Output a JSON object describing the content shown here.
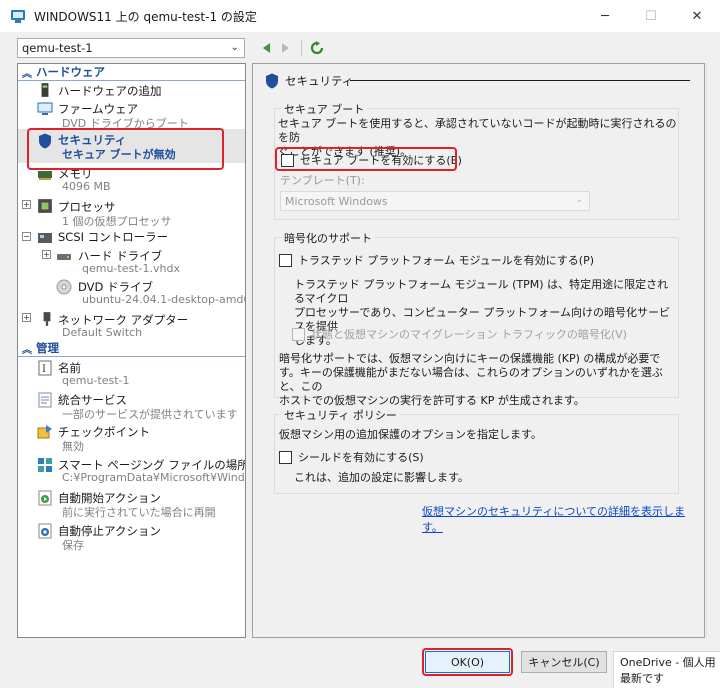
{
  "window": {
    "title": "WINDOWS11 上の qemu-test-1 の設定"
  },
  "vm_selector": {
    "value": "qemu-test-1"
  },
  "tree": {
    "hardware_section": "ハードウェア",
    "management_section": "管理",
    "add_hardware": "ハードウェアの追加",
    "firmware": {
      "label": "ファームウェア",
      "sub": "DVD ドライブからブート"
    },
    "security": {
      "label": "セキュリティ",
      "sub": "セキュア ブートが無効"
    },
    "memory": {
      "label": "メモリ",
      "sub": "4096 MB"
    },
    "processor": {
      "label": "プロセッサ",
      "sub": "1 個の仮想プロセッサ"
    },
    "scsi": {
      "label": "SCSI コントローラー"
    },
    "hard_drive": {
      "label": "ハード ドライブ",
      "sub": "qemu-test-1.vhdx"
    },
    "dvd_drive": {
      "label": "DVD ドライブ",
      "sub": "ubuntu-24.04.1-desktop-amd6..."
    },
    "network": {
      "label": "ネットワーク アダプター",
      "sub": "Default Switch"
    },
    "name": {
      "label": "名前",
      "sub": "qemu-test-1"
    },
    "integration": {
      "label": "統合サービス",
      "sub": "一部のサービスが提供されています"
    },
    "checkpoint": {
      "label": "チェックポイント",
      "sub": "無効"
    },
    "smart_paging": {
      "label": "スマート ページング ファイルの場所",
      "sub": "C:¥ProgramData¥Microsoft¥Windo..."
    },
    "auto_start": {
      "label": "自動開始アクション",
      "sub": "前に実行されていた場合に再開"
    },
    "auto_stop": {
      "label": "自動停止アクション",
      "sub": "保存"
    }
  },
  "panel": {
    "title": "セキュリティ",
    "secure_boot": {
      "group_title": "セキュア ブート",
      "description_line1": "セキュア ブートを使用すると、承認されていないコードが起動時に実行されるのを防",
      "description_line2": "ぐことができます (推奨)。",
      "checkbox_label": "セキュア ブートを有効にする(E)",
      "checked": false,
      "template_label": "テンプレート(T):",
      "template_value": "Microsoft Windows"
    },
    "encryption": {
      "group_title": "暗号化のサポート",
      "tpm_checkbox": "トラステッド プラットフォーム モジュールを有効にする(P)",
      "tpm_desc_line1": "トラステッド プラットフォーム モジュール (TPM) は、特定用途に限定されるマイクロ",
      "tpm_desc_line2": "プロセッサーであり、コンピューター プラットフォーム向けの暗号化サービスを提供",
      "tpm_desc_line3": "します。",
      "migration_checkbox": "状態と仮想マシンのマイグレーション トラフィックの暗号化(V)",
      "kp_line1": "暗号化サポートでは、仮想マシン向けにキーの保護機能 (KP) の構成が必要で",
      "kp_line2": "す。キーの保護機能がまだない場合は、これらのオプションのいずれかを選ぶと、この",
      "kp_line3": "ホストでの仮想マシンの実行を許可する KP が生成されます。"
    },
    "policy": {
      "group_title": "セキュリティ ポリシー",
      "description": "仮想マシン用の追加保護のオプションを指定します。",
      "shield_checkbox": "シールドを有効にする(S)",
      "shield_note": "これは、追加の設定に影響します。"
    },
    "more_link": "仮想マシンのセキュリティについての詳細を表示します。"
  },
  "buttons": {
    "ok": "OK(O)",
    "cancel": "キャンセル(C)"
  },
  "notification": {
    "line1": "OneDrive - 個人用",
    "line2": "最新です"
  },
  "colors": {
    "accent": "#0078d7",
    "highlight": "#e0202a",
    "link": "#0b47c8",
    "section": "#1e4e9c"
  }
}
